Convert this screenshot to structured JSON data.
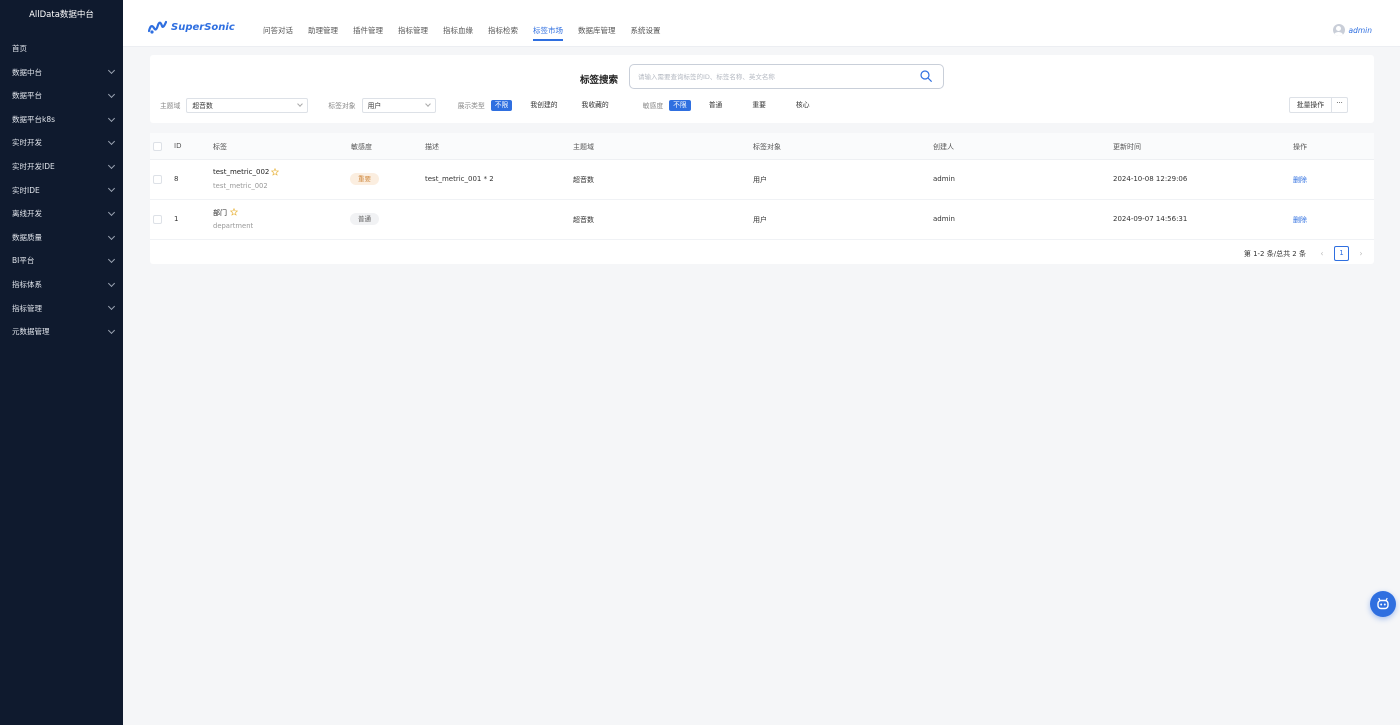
{
  "sidebar": {
    "title": "AllData数据中台",
    "items": [
      {
        "label": "首页",
        "has_children": false
      },
      {
        "label": "数据中台",
        "has_children": true
      },
      {
        "label": "数据平台",
        "has_children": true
      },
      {
        "label": "数据平台k8s",
        "has_children": true
      },
      {
        "label": "实时开发",
        "has_children": true
      },
      {
        "label": "实时开发IDE",
        "has_children": true
      },
      {
        "label": "实时IDE",
        "has_children": true
      },
      {
        "label": "离线开发",
        "has_children": true
      },
      {
        "label": "数据质量",
        "has_children": true
      },
      {
        "label": "BI平台",
        "has_children": true
      },
      {
        "label": "指标体系",
        "has_children": true
      },
      {
        "label": "指标管理",
        "has_children": true
      },
      {
        "label": "元数据管理",
        "has_children": true
      }
    ]
  },
  "header": {
    "logo_text": "SuperSonic",
    "nav": [
      "问答对话",
      "助理管理",
      "插件管理",
      "指标管理",
      "指标血缘",
      "指标检索",
      "标签市场",
      "数据库管理",
      "系统设置"
    ],
    "active_nav_index": 6,
    "user_name": "admin"
  },
  "search": {
    "title": "标签搜索",
    "placeholder": "请输入需要查询标签的ID、标签名称、英文名称"
  },
  "filters": {
    "domain_label": "主题域",
    "domain_value": "超音数",
    "object_label": "标签对象",
    "object_value": "用户",
    "display_label": "展示类型",
    "display_options": [
      "不限",
      "我创建的",
      "我收藏的"
    ],
    "sensitivity_label": "敏感度",
    "sensitivity_options": [
      "不限",
      "普通",
      "重要",
      "核心"
    ],
    "bulk_button": "批量操作",
    "more_button": "···"
  },
  "table": {
    "columns": [
      "ID",
      "标签",
      "敏感度",
      "描述",
      "主题域",
      "标签对象",
      "创建人",
      "更新时间",
      "操作"
    ],
    "rows": [
      {
        "id": "8",
        "name": "test_metric_002",
        "biz_name": "test_metric_002",
        "sensitivity": "重要",
        "sensitivity_type": "important",
        "description": "test_metric_001 * 2",
        "domain": "超音数",
        "object": "用户",
        "creator": "admin",
        "updated": "2024-10-08 12:29:06",
        "action": "删除"
      },
      {
        "id": "1",
        "name": "部门",
        "biz_name": "department",
        "sensitivity": "普通",
        "sensitivity_type": "normal",
        "description": "",
        "domain": "超音数",
        "object": "用户",
        "creator": "admin",
        "updated": "2024-09-07 14:56:31",
        "action": "删除"
      }
    ]
  },
  "pagination": {
    "total_text": "第 1-2 条/总共 2 条",
    "current_page": "1",
    "prev_icon": "‹",
    "next_icon": "›"
  },
  "colors": {
    "sidebar_bg": "#0f1a2e",
    "accent": "#2f6fe0",
    "important_tag": "#d08a40"
  }
}
